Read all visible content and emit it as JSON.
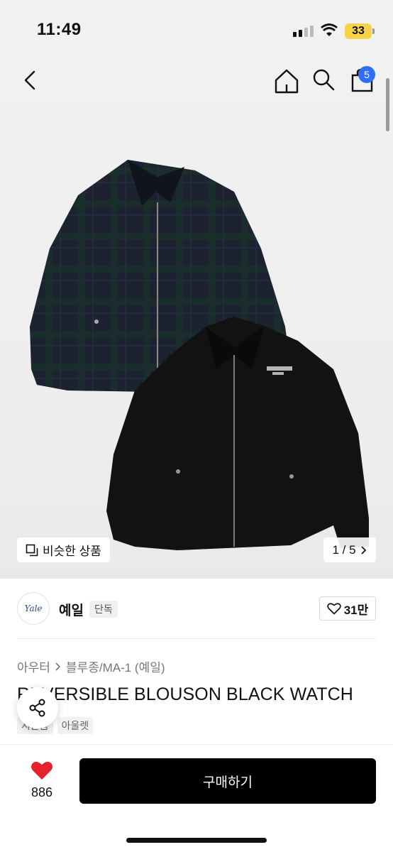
{
  "status": {
    "time": "11:49",
    "battery": "33"
  },
  "header": {
    "cart_count": "5"
  },
  "gallery": {
    "similar_label": "비슷한 상품",
    "pager": "1 / 5"
  },
  "brand": {
    "logo_text": "Yale",
    "name": "예일",
    "tag": "단독",
    "likes": "31만"
  },
  "breadcrumb": {
    "category": "아우터",
    "subcategory": "블루종/MA-1 (예일)"
  },
  "product": {
    "title": "REVERSIBLE BLOUSON BLACK WATCH"
  },
  "tags": [
    "시즌몸",
    "아울렛"
  ],
  "bottom": {
    "wish_count": "886",
    "buy_label": "구매하기"
  },
  "colors": {
    "accent_badge": "#2f6ef6",
    "heart": "#e8222a",
    "buy_button": "#000000"
  }
}
